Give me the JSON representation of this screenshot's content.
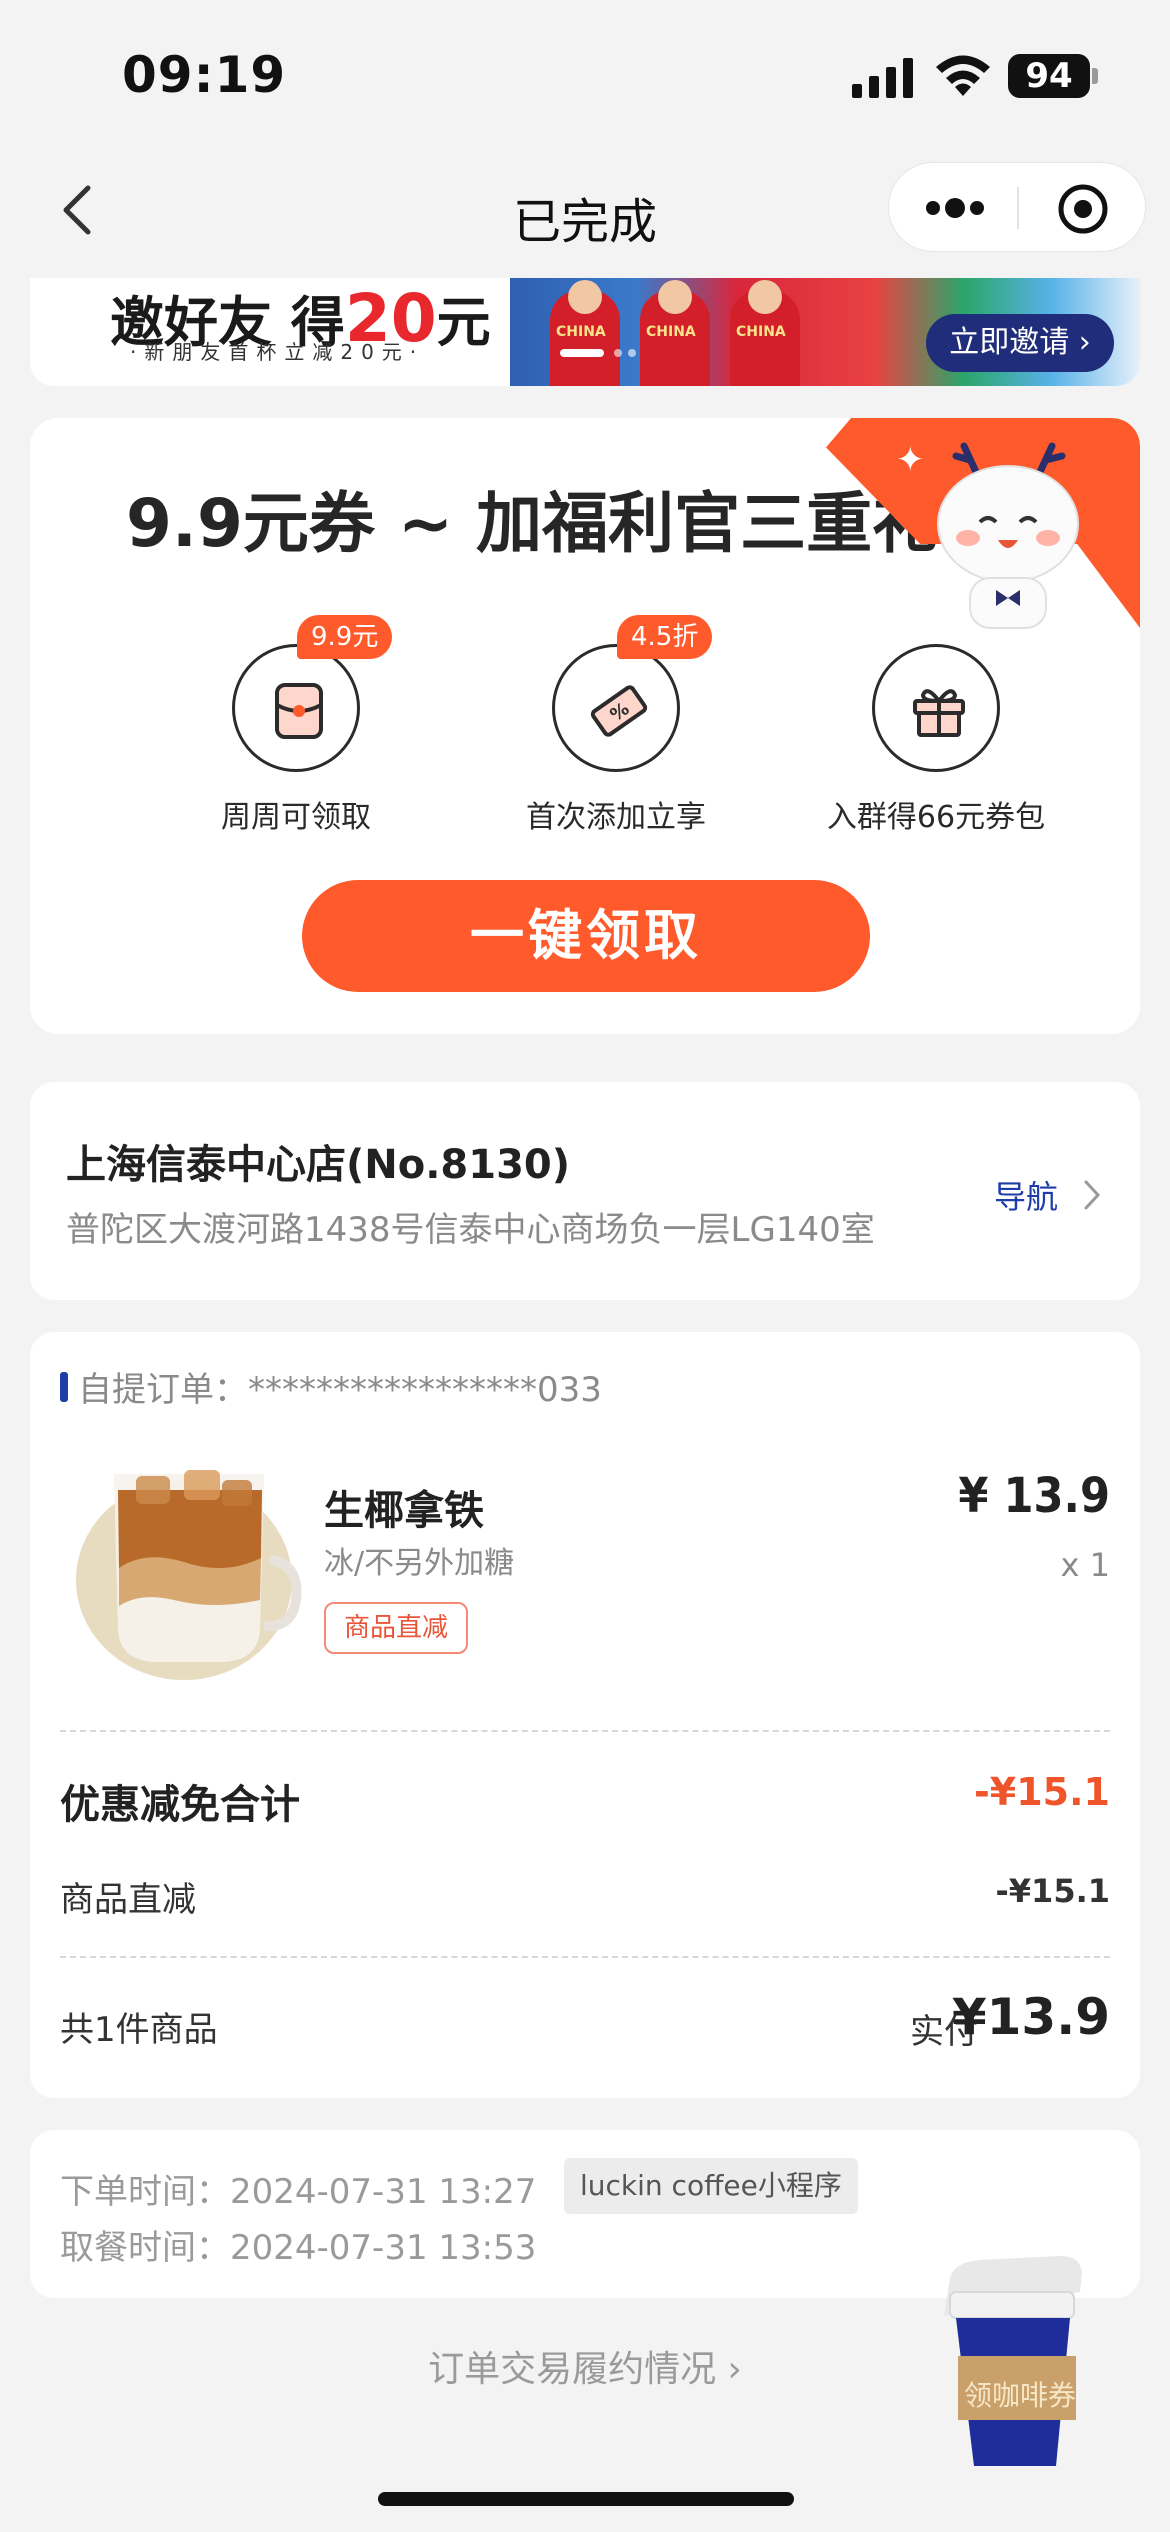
{
  "status_bar": {
    "time": "09:19",
    "battery": "94"
  },
  "nav": {
    "title": "已完成"
  },
  "banner": {
    "title_prefix": "邀好友 得",
    "title_amount": "20",
    "title_suffix": "元",
    "subtitle": "·新朋友首杯立减20元·",
    "player_label": "CHINA",
    "invite_label": "立即邀请"
  },
  "coupon": {
    "title": "9.9元券 ~ 加福利官三重礼",
    "perks": [
      {
        "badge": "9.9元",
        "label": "周周可领取",
        "icon": "red-packet-icon"
      },
      {
        "badge": "4.5折",
        "label": "首次添加立享",
        "icon": "discount-ticket-icon"
      },
      {
        "badge": "",
        "label": "入群得66元券包",
        "icon": "gift-box-icon"
      }
    ],
    "button": "一键领取"
  },
  "store": {
    "name": "上海信泰中心店(No.8130)",
    "address": "普陀区大渡河路1438号信泰中心商场负一层LG140室",
    "nav_label": "导航"
  },
  "order": {
    "label": "自提订单：",
    "number": "*****************033",
    "item": {
      "name": "生椰拿铁",
      "spec": "冰/不另外加糖",
      "tag": "商品直减",
      "price": "¥ 13.9",
      "qty": "x 1"
    },
    "discount_title": "优惠减免合计",
    "discount_total": "-¥15.1",
    "discount_item_label": "商品直减",
    "discount_item_value": "-¥15.1",
    "count_label": "共1件商品",
    "paid_label": "实付",
    "paid_value": "¥13.9"
  },
  "times": {
    "order_time_label": "下单时间：",
    "order_time": "2024-07-31 13:27",
    "source": "luckin coffee小程序",
    "pickup_time_label": "取餐时间：",
    "pickup_time": "2024-07-31 13:53"
  },
  "footer": {
    "trade_link": "订单交易履约情况",
    "coffee_coupon": "领咖啡券"
  },
  "colors": {
    "accent_orange": "#ff5a2c",
    "brand_blue": "#1e3da8",
    "discount_red": "#f0542a"
  }
}
